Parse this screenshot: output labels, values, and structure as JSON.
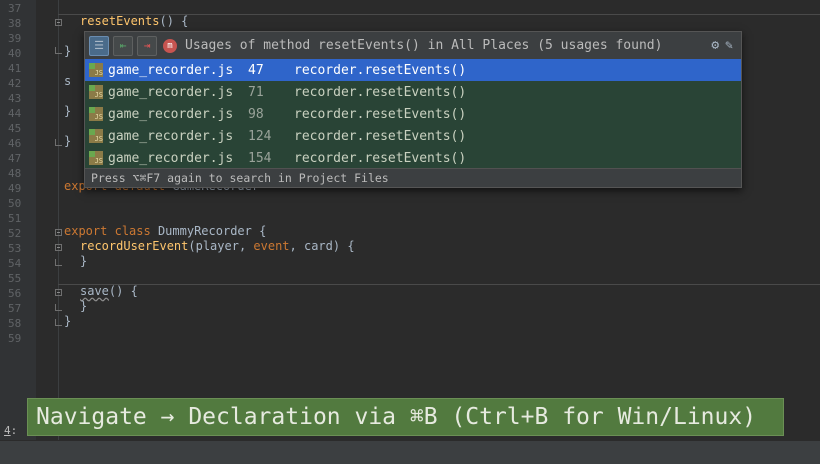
{
  "gutter": {
    "line_numbers": [
      "37",
      "38",
      "39",
      "40",
      "41",
      "42",
      "43",
      "44",
      "45",
      "46",
      "47",
      "48",
      "49",
      "50",
      "51",
      "52",
      "53",
      "54",
      "55",
      "56",
      "57",
      "58",
      "59"
    ]
  },
  "code": {
    "l38_fn": "resetEvents",
    "l38_rest": "() {",
    "l39": "}",
    "l42": "s",
    "l44": "}",
    "l46": "}",
    "l49_kw": "export default",
    "l49_rest": " GameRecorder",
    "l52_kw1": "export",
    "l52_kw2": "class",
    "l52_rest": " DummyRecorder {",
    "l53_fn": "recordUserEvent",
    "l53_p1": "(player, ",
    "l53_p2": "event",
    "l53_p3": ", card) {",
    "l54": "}",
    "l56_fn": "save",
    "l56_rest": "() {",
    "l57": "}",
    "l58": "}"
  },
  "popup": {
    "title": "Usages of method resetEvents() in All Places (5 usages found)",
    "toolbar": {
      "merge_icon": "merge-usages-icon",
      "prev_icon": "previous-occurrence-icon",
      "next_icon": "next-occurrence-icon",
      "method_icon": "m",
      "settings_icon": "settings-icon",
      "pin_icon": "pin-icon"
    },
    "usages": [
      {
        "file": "game_recorder.js",
        "line": "47",
        "code": "recorder.resetEvents()"
      },
      {
        "file": "game_recorder.js",
        "line": "71",
        "code": "recorder.resetEvents()"
      },
      {
        "file": "game_recorder.js",
        "line": "98",
        "code": "recorder.resetEvents()"
      },
      {
        "file": "game_recorder.js",
        "line": "124",
        "code": "recorder.resetEvents()"
      },
      {
        "file": "game_recorder.js",
        "line": "154",
        "code": "recorder.resetEvents()"
      }
    ],
    "file_icon_label": "JS",
    "footer": "Press ⌥⌘F7 again to search in Project Files"
  },
  "caption": "Navigate → Declaration via ⌘B (Ctrl+B for Win/Linux)",
  "tool_tab": {
    "num": "4",
    "sep": ":"
  },
  "colors": {
    "editor_bg": "#2b2b2b",
    "keyword": "#cc7832",
    "function": "#ffc66d",
    "selection": "#2f65ca",
    "usage_row": "#294436",
    "caption_bg": "#527a3f"
  }
}
